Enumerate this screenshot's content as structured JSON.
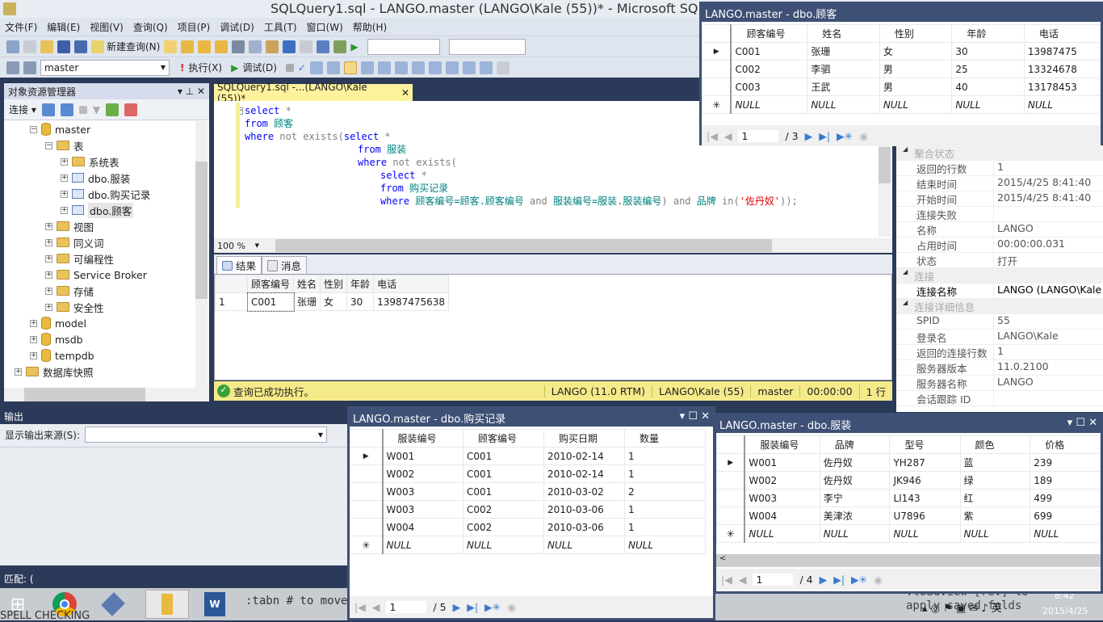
{
  "window": {
    "title": "SQLQuery1.sql - LANGO.master (LANGO\\Kale (55))* - Microsoft SQL Server"
  },
  "menu": [
    "文件(F)",
    "编辑(E)",
    "视图(V)",
    "查询(Q)",
    "项目(P)",
    "调试(D)",
    "工具(T)",
    "窗口(W)",
    "帮助(H)"
  ],
  "toolbar": {
    "new_query": "新建查询(N)",
    "database": "master",
    "execute": "执行(X)",
    "debug": "调试(D)"
  },
  "object_explorer": {
    "title": "对象资源管理器",
    "connect": "连接",
    "tree": [
      {
        "label": "master",
        "icon": "database",
        "sign": "−",
        "level": 3
      },
      {
        "label": "表",
        "icon": "folder",
        "sign": "−",
        "level": 4
      },
      {
        "label": "系统表",
        "icon": "folder",
        "sign": "+",
        "level": 5
      },
      {
        "label": "dbo.服装",
        "icon": "table",
        "sign": "+",
        "level": 5
      },
      {
        "label": "dbo.购买记录",
        "icon": "table",
        "sign": "+",
        "level": 5
      },
      {
        "label": "dbo.顾客",
        "icon": "table",
        "sign": "+",
        "level": 5,
        "selected": true
      },
      {
        "label": "视图",
        "icon": "folder",
        "sign": "+",
        "level": 4
      },
      {
        "label": "同义词",
        "icon": "folder",
        "sign": "+",
        "level": 4
      },
      {
        "label": "可编程性",
        "icon": "folder",
        "sign": "+",
        "level": 4
      },
      {
        "label": "Service Broker",
        "icon": "folder",
        "sign": "+",
        "level": 4
      },
      {
        "label": "存储",
        "icon": "folder",
        "sign": "+",
        "level": 4
      },
      {
        "label": "安全性",
        "icon": "folder",
        "sign": "+",
        "level": 4
      },
      {
        "label": "model",
        "icon": "database",
        "sign": "+",
        "level": 3
      },
      {
        "label": "msdb",
        "icon": "database",
        "sign": "+",
        "level": 3
      },
      {
        "label": "tempdb",
        "icon": "database",
        "sign": "+",
        "level": 3
      },
      {
        "label": "数据库快照",
        "icon": "folder",
        "sign": "+",
        "level": 2
      }
    ]
  },
  "editor": {
    "tab": "SQLQuery1.sql -...(LANGO\\Kale (55))*",
    "zoom": "100 %",
    "lines": [
      {
        "indent": 0,
        "tokens": [
          [
            "select",
            "kw"
          ],
          [
            " *",
            "op"
          ]
        ]
      },
      {
        "indent": 0,
        "tokens": [
          [
            "from",
            "kw"
          ],
          [
            " 顾客",
            "id"
          ]
        ]
      },
      {
        "indent": 0,
        "tokens": [
          [
            "where",
            "kw"
          ],
          [
            " not exists",
            "op"
          ],
          [
            "(",
            "op"
          ],
          [
            "select",
            "kw"
          ],
          [
            " *",
            "op"
          ]
        ]
      },
      {
        "indent": 20,
        "tokens": [
          [
            "from",
            "kw"
          ],
          [
            " 服装",
            "id"
          ]
        ]
      },
      {
        "indent": 20,
        "tokens": [
          [
            "where",
            "kw"
          ],
          [
            " not exists(",
            "op"
          ]
        ]
      },
      {
        "indent": 24,
        "tokens": [
          [
            "select",
            "kw"
          ],
          [
            " *",
            "op"
          ]
        ]
      },
      {
        "indent": 24,
        "tokens": [
          [
            "from",
            "kw"
          ],
          [
            " 购买记录",
            "id"
          ]
        ]
      },
      {
        "indent": 24,
        "tokens": [
          [
            "where",
            "kw"
          ],
          [
            " 顾客编号=顾客.顾客编号 ",
            "id"
          ],
          [
            "and",
            "op"
          ],
          [
            " 服装编号=服装.服装编号",
            "id"
          ],
          [
            ") ",
            "op"
          ],
          [
            "and",
            "op"
          ],
          [
            " 品牌 ",
            "id"
          ],
          [
            "in",
            "op"
          ],
          [
            "(",
            "op"
          ],
          [
            "'佐丹奴'",
            "str"
          ],
          [
            "));",
            "op"
          ]
        ]
      }
    ]
  },
  "results": {
    "tab_results": "结果",
    "tab_messages": "消息",
    "columns": [
      "",
      "顾客编号",
      "姓名",
      "性别",
      "年龄",
      "电话"
    ],
    "rows": [
      [
        "1",
        "C001",
        "张珊",
        "女",
        "30",
        "13987475638"
      ]
    ]
  },
  "status": {
    "message": "查询已成功执行。",
    "server": "LANGO (11.0 RTM)",
    "user": "LANGO\\Kale (55)",
    "db": "master",
    "time": "00:00:00",
    "rows": "1 行",
    "color": "#f5ea8a"
  },
  "properties": [
    {
      "cat": "聚合状态"
    },
    {
      "k": "返回的行数",
      "v": "1"
    },
    {
      "k": "结束时间",
      "v": "2015/4/25 8:41:40"
    },
    {
      "k": "开始时间",
      "v": "2015/4/25 8:41:40"
    },
    {
      "k": "连接失败",
      "v": ""
    },
    {
      "k": "名称",
      "v": "LANGO"
    },
    {
      "k": "占用时间",
      "v": "00:00:00.031"
    },
    {
      "k": "状态",
      "v": "打开"
    },
    {
      "cat": "连接"
    },
    {
      "k": "连接名称",
      "v": "LANGO (LANGO\\Kale"
    },
    {
      "cat": "连接详细信息"
    },
    {
      "k": "SPID",
      "v": "55"
    },
    {
      "k": "登录名",
      "v": "LANGO\\Kale"
    },
    {
      "k": "返回的连接行数",
      "v": "1"
    },
    {
      "k": "服务器版本",
      "v": "11.0.2100"
    },
    {
      "k": "服务器名称",
      "v": "LANGO"
    },
    {
      "k": "会话跟踪 ID",
      "v": ""
    }
  ],
  "output": {
    "title": "输出",
    "source_label": "显示输出来源(S):",
    "match": "匹配: ("
  },
  "win_customers": {
    "title": "LANGO.master - dbo.顾客",
    "columns": [
      "顾客编号",
      "姓名",
      "性别",
      "年龄",
      "电话"
    ],
    "rows": [
      [
        "C001",
        "张珊",
        "女",
        "30",
        "13987475"
      ],
      [
        "C002",
        "李驷",
        "男",
        "25",
        "13324678"
      ],
      [
        "C003",
        "王武",
        "男",
        "40",
        "13178453"
      ],
      [
        "NULL",
        "NULL",
        "NULL",
        "NULL",
        "NULL"
      ]
    ],
    "page": "1",
    "total": "/ 3"
  },
  "win_purchases": {
    "title": "LANGO.master - dbo.购买记录",
    "columns": [
      "服装编号",
      "顾客编号",
      "购买日期",
      "数量"
    ],
    "rows": [
      [
        "W001",
        "C001",
        "2010-02-14",
        "1"
      ],
      [
        "W002",
        "C001",
        "2010-02-14",
        "1"
      ],
      [
        "W003",
        "C001",
        "2010-03-02",
        "2"
      ],
      [
        "W003",
        "C002",
        "2010-03-06",
        "1"
      ],
      [
        "W004",
        "C002",
        "2010-03-06",
        "1"
      ],
      [
        "NULL",
        "NULL",
        "NULL",
        "NULL"
      ]
    ],
    "page": "1",
    "total": "/ 5"
  },
  "win_clothing": {
    "title": "LANGO.master - dbo.服装",
    "columns": [
      "服装编号",
      "品牌",
      "型号",
      "颜色",
      "价格"
    ],
    "rows": [
      [
        "W001",
        "佐丹奴",
        "YH287",
        "蓝",
        "239"
      ],
      [
        "W002",
        "佐丹奴",
        "JK946",
        "绿",
        "189"
      ],
      [
        "W003",
        "李宁",
        "LI143",
        "红",
        "499"
      ],
      [
        "W004",
        "美津浓",
        "U7896",
        "紫",
        "699"
      ],
      [
        "NULL",
        "NULL",
        "NULL",
        "NULL",
        "NULL"
      ]
    ],
    "page": "1",
    "total": "/ 4"
  },
  "taskbar": {
    "bleed_left": ":tabn # to move",
    "bleed_spell": "SPELL CHECKING",
    "bleed_right": ":loadview [rev] to apply saved folds",
    "time": "8:42",
    "date": "2015/4/25"
  }
}
